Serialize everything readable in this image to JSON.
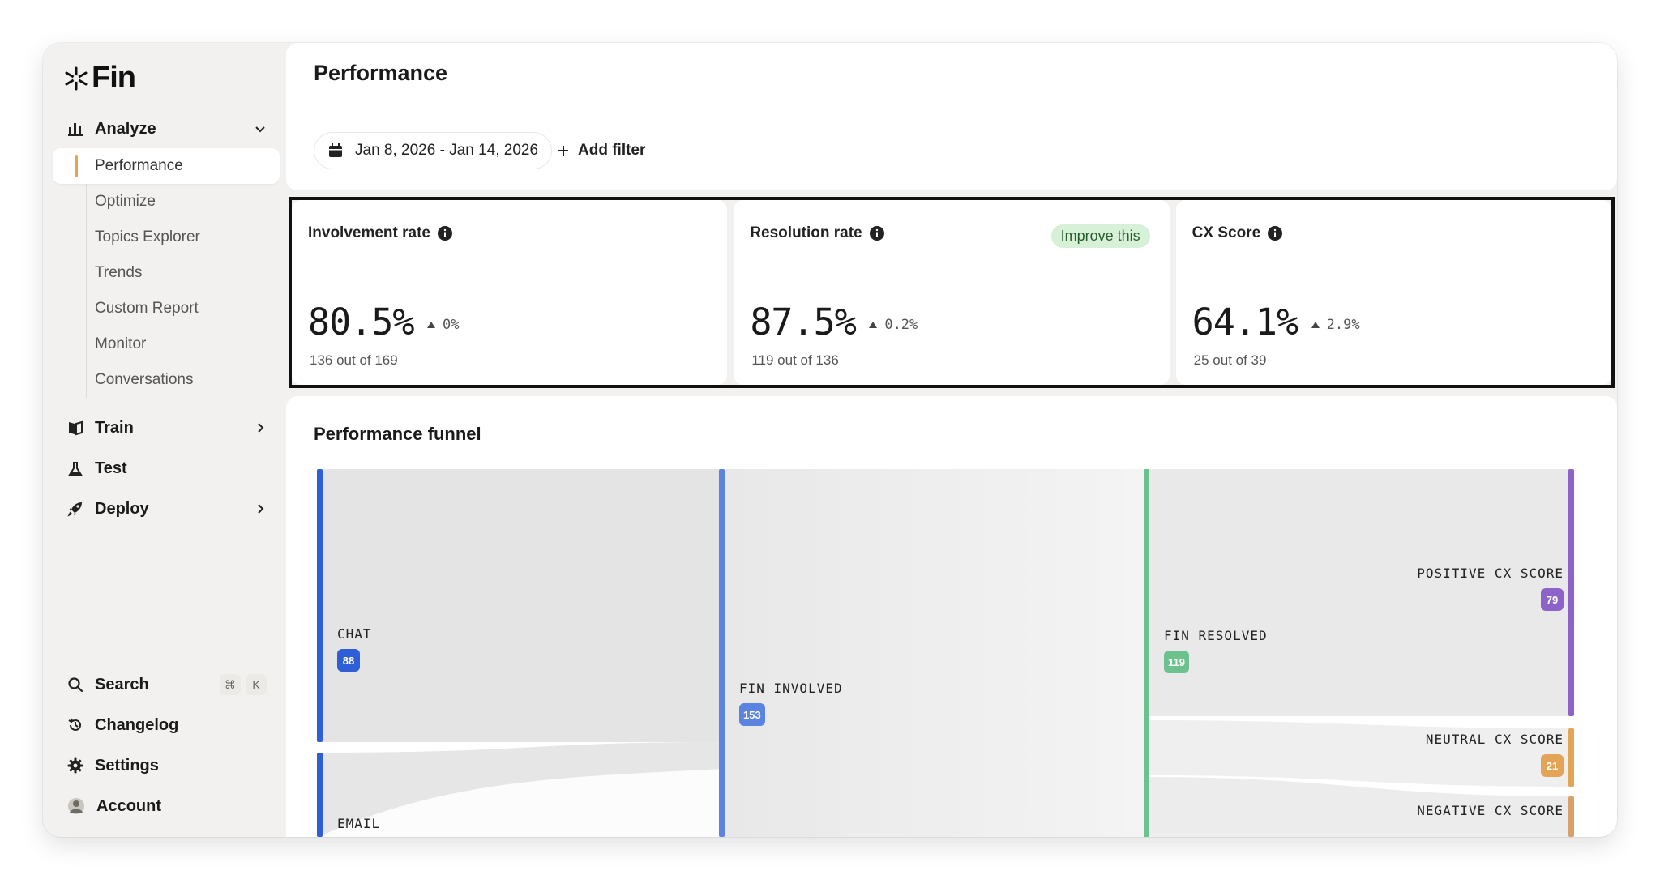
{
  "app": {
    "name": "Fin"
  },
  "sidebar": {
    "analyze": {
      "label": "Analyze"
    },
    "analyze_items": [
      {
        "label": "Performance",
        "active": true
      },
      {
        "label": "Optimize"
      },
      {
        "label": "Topics Explorer"
      },
      {
        "label": "Trends"
      },
      {
        "label": "Custom Report"
      },
      {
        "label": "Monitor"
      },
      {
        "label": "Conversations"
      }
    ],
    "train": {
      "label": "Train"
    },
    "test": {
      "label": "Test"
    },
    "deploy": {
      "label": "Deploy"
    },
    "search": {
      "label": "Search",
      "shortcut": [
        "⌘",
        "K"
      ]
    },
    "changelog": {
      "label": "Changelog"
    },
    "settings": {
      "label": "Settings"
    },
    "account": {
      "label": "Account"
    }
  },
  "header": {
    "title": "Performance",
    "date_range": "Jan 8, 2026 - Jan 14, 2026",
    "add_filter": "Add filter"
  },
  "metrics": [
    {
      "title": "Involvement rate",
      "value": "80.5%",
      "delta": "0%",
      "detail": "136 out of 169"
    },
    {
      "title": "Resolution rate",
      "value": "87.5%",
      "delta": "0.2%",
      "detail": "119 out of 136",
      "action": "Improve this"
    },
    {
      "title": "CX Score",
      "value": "64.1%",
      "delta": "2.9%",
      "detail": "25 out of 39"
    }
  ],
  "funnel": {
    "title": "Performance funnel",
    "nodes": [
      {
        "label": "CHAT",
        "count": "88",
        "color": "#2f5fd6"
      },
      {
        "label": "EMAIL",
        "count": "",
        "color": "#2f5fd6"
      },
      {
        "label": "FIN INVOLVED",
        "count": "153",
        "color": "#5a84e0"
      },
      {
        "label": "FIN RESOLVED",
        "count": "119",
        "color": "#6cc18e"
      },
      {
        "label": "POSITIVE CX SCORE",
        "count": "79",
        "color": "#8c64c9"
      },
      {
        "label": "NEUTRAL CX SCORE",
        "count": "21",
        "color": "#e4a456"
      },
      {
        "label": "NEGATIVE CX SCORE",
        "count": "",
        "color": "#d9a06a"
      }
    ]
  },
  "colors": {
    "accent": "#e4a456",
    "improve_bg": "#d7f1d8"
  }
}
